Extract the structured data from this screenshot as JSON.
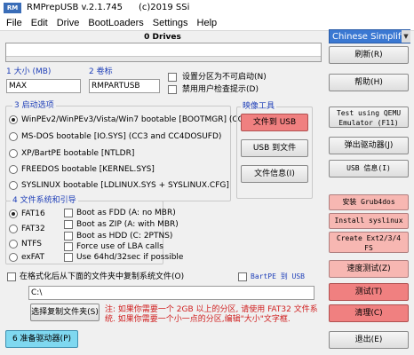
{
  "window": {
    "app_icon_text": "RM",
    "title": "RMPrepUSB v.2.1.745",
    "copyright": "(c)2019 SSi"
  },
  "menu": [
    "File",
    "Edit",
    "Drive",
    "BootLoaders",
    "Settings",
    "Help"
  ],
  "drives": {
    "label": "0 Drives",
    "list_value": ""
  },
  "language": {
    "selected": "Chinese Simplified"
  },
  "fields": {
    "size": {
      "label": "1 大小 (MB)",
      "value": "MAX"
    },
    "volume": {
      "label": "2 卷标",
      "value": "RMPARTUSB"
    }
  },
  "checks_top": [
    {
      "label": "设置分区为不可启动(N)",
      "checked": false
    },
    {
      "label": "禁用用户检查提示(D)",
      "checked": false
    }
  ],
  "boot_group": {
    "title": "3 启动选项",
    "options": [
      {
        "label": "WinPEv2/WinPEv3/Vista/Win7 bootable [BOOTMGR] (CC4)",
        "selected": true
      },
      {
        "label": "MS-DOS bootable [IO.SYS]    (CC3 and CC4DOSUFD)",
        "selected": false
      },
      {
        "label": "XP/BartPE bootable [NTLDR]",
        "selected": false
      },
      {
        "label": "FREEDOS bootable [KERNEL.SYS]",
        "selected": false
      },
      {
        "label": "SYSLINUX bootable [LDLINUX.SYS + SYSLINUX.CFG]",
        "selected": false
      }
    ]
  },
  "image_tools": {
    "title": "映像工具",
    "buttons": [
      "文件到 USB",
      "USB 到文件",
      "文件信息(I)"
    ]
  },
  "fs_group": {
    "title": "4 文件系统和引导",
    "filesystems": [
      {
        "label": "FAT16",
        "selected": true
      },
      {
        "label": "FAT32",
        "selected": false
      },
      {
        "label": "NTFS",
        "selected": false
      },
      {
        "label": "exFAT",
        "selected": false
      }
    ],
    "options": [
      {
        "label": "Boot as FDD (A: no MBR)",
        "checked": false
      },
      {
        "label": "Boot as ZIP (A: with MBR)",
        "checked": false
      },
      {
        "label": "Boot as HDD (C: 2PTNS)",
        "checked": false
      },
      {
        "label": "Force use of LBA calls",
        "checked": false
      },
      {
        "label": "Use 64hd/32sec if possible",
        "checked": false
      }
    ]
  },
  "copy_files": {
    "label": "在格式化后从下面的文件夹中复制系统文件(O)",
    "checked": false
  },
  "bartpe": {
    "label": "BartPE 到 USB",
    "checked": false
  },
  "path": {
    "value": "C:\\"
  },
  "choose_folder_button": "选择复制文件夹(S)",
  "note": {
    "line1": "注: 如果你需要一个 2GB 以上的分区, 请使用 FAT32 文件系",
    "line2": "统. 如果你需要一个小一点的分区,编辑\"大小\"文字框."
  },
  "prepare_button": "6 准备驱动器(P)",
  "right_buttons": {
    "refresh": "刷新(R)",
    "help": "帮助(H)",
    "test_qemu": [
      "Test using QEMU",
      "Emulator (F11)"
    ],
    "eject": "弹出驱动器(J)",
    "usb_info": "USB 信息(I)",
    "install_grub4dos": "安装 Grub4dos",
    "install_syslinux": "Install syslinux",
    "create_ext": [
      "Create Ext2/3/4",
      "FS"
    ],
    "speed_test": "速度测试(Z)",
    "test": "测试(T)",
    "clean": "清理(C)",
    "exit": "退出(E)"
  },
  "colors": {
    "highlight_red": "#f08080",
    "pink": "#f7b7b2",
    "cyan": "#7fd8f0",
    "language_blue": "#3a78d2",
    "label_blue": "#1f3fb8",
    "note_red": "#d02020"
  }
}
